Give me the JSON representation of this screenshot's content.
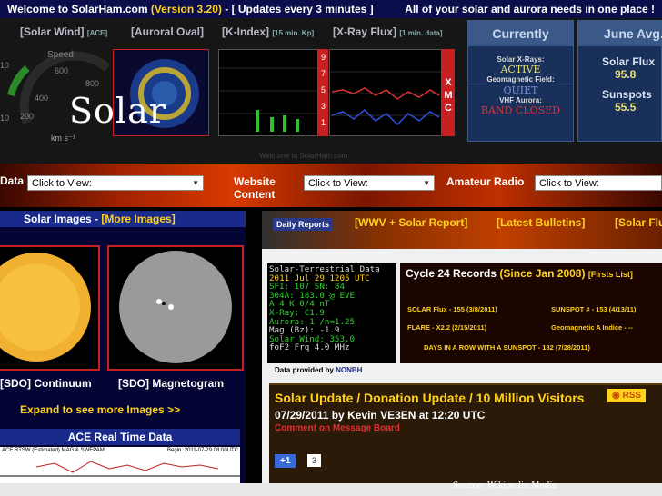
{
  "topbar": {
    "welcome": "Welcome to SolarHam.com",
    "version": "(Version 3.20)",
    "updates": "- [ Updates every 3 minutes ]",
    "tagline": "All of your solar and aurora needs in one place !"
  },
  "header": {
    "solar_wind": "[Solar Wind]",
    "ace": "[ACE]",
    "auroral_oval": "[Auroral Oval]",
    "kindex": "[K-Index]",
    "kindex_sub": "[15 min. Kp]",
    "xray": "[X-Ray Flux]",
    "xray_sub": "[1 min. data]",
    "kindex_scale": [
      "9",
      "7",
      "5",
      "3",
      "1"
    ],
    "xray_letters": [
      "X",
      "M",
      "C"
    ],
    "footer": "Welcome to SolarHam.com"
  },
  "gauge": {
    "label": "Speed",
    "ticks": [
      "10",
      "400",
      "600",
      "800",
      "10",
      "200"
    ],
    "unit": "km s⁻¹"
  },
  "currently": {
    "title": "Currently",
    "xray_k": "Solar X-Rays:",
    "xray_v": "ACTIVE",
    "geo_k": "Geomagnetic Field:",
    "geo_v": "QUIET",
    "vhf_k": "VHF Aurora:",
    "vhf_v": "BAND CLOSED"
  },
  "june": {
    "title": "June Avg.",
    "flux_k": "Solar Flux",
    "flux_v": "95.8",
    "spots_k": "Sunspots",
    "spots_v": "55.5"
  },
  "overlay": {
    "title": "Solar"
  },
  "nav": {
    "data": "Data",
    "website": "Website",
    "content": "Content",
    "ham": "Amateur Radio",
    "select1": "Click to View:",
    "select2": "Click to View:",
    "select3": "Click to View:"
  },
  "left": {
    "images_title": "Solar Images - ",
    "more": "[More Images]",
    "cap1": "[SDO] Continuum",
    "cap2": "[SDO] Magnetogram",
    "expand": "Expand to see more Images >>",
    "ace_title": "ACE Real Time Data",
    "ace_sub": "ACE RTSW (Estimated) MAG & SWEPAM",
    "ace_begin": "Begin: 2011-07-29 08:00UTC"
  },
  "right": {
    "weekly": "Daily Reports",
    "wwv": "[WWV + Solar Report]",
    "bulletins": "[Latest Bulletins]",
    "solarflux": "[Solar Flux]"
  },
  "terminal": {
    "lines": [
      "Solar-Terrestrial Data",
      "2011 Jul 29 1205 UTC",
      "SFI: 107 SN:  84",
      "304A: 183.0 @ EVE",
      "A   4  K  0/4 nT",
      "X-Ray: C1.9",
      "Aurora: 1 /n=1.25",
      "Mag (Bz):  -1.9",
      "Solar Wind: 353.0",
      "foF2 Frq 4.0   MHz"
    ],
    "provided": "Data provided by ",
    "nonbh": "NONBH"
  },
  "cycle": {
    "title": "Cycle 24 Records",
    "since": "(Since Jan 2008)",
    "firsts": "[Firsts List]",
    "flux": "SOLAR Flux - 155 (3/8/2011)",
    "spot": "SUNSPOT # - 153 (4/13/11)",
    "flare": "FLARE - X2.2 (2/15/2011)",
    "geo": "Geomagnetic A Indice - --",
    "days": "DAYS IN A ROW WITH A SUNSPOT - 182 (7/28/2011)"
  },
  "update": {
    "title": "Solar Update / Donation Update / 10 Million Visitors",
    "date": "07/29/2011 by Kevin VE3EN at 12:20 UTC",
    "comment": "Comment on Message Board",
    "rss": "RSS",
    "plus": "+1",
    "count": "3"
  },
  "credit": "Source: Wikipedia Media"
}
